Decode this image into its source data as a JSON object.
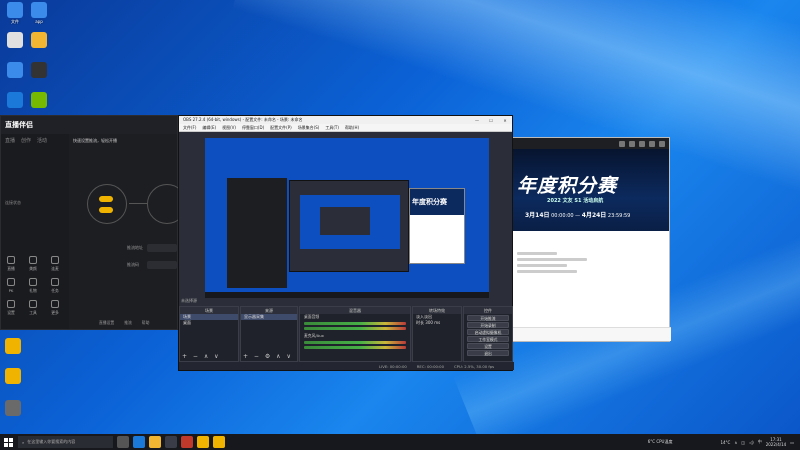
{
  "desktop": {
    "icons": [
      {
        "label": "文件",
        "color": "#3b8bea"
      },
      {
        "label": "app",
        "color": "#3b8bea"
      },
      {
        "label": "",
        "color": "#e0e0e0"
      },
      {
        "label": "",
        "color": "#f2b632"
      },
      {
        "label": "",
        "color": "#3b8bea"
      },
      {
        "label": "",
        "color": "#333333"
      },
      {
        "label": "",
        "color": "#1b7ad9"
      },
      {
        "label": "",
        "color": "#76b900"
      },
      {
        "label": "",
        "color": "#f0b400"
      },
      {
        "label": "",
        "color": "#f0b400"
      },
      {
        "label": "",
        "color": "#6a6a6a"
      }
    ]
  },
  "zhibo_app": {
    "logo": "直播伴侣",
    "tabs": [
      "直播",
      "创作",
      "活动"
    ],
    "hint": "快速设置推流，轻松开播",
    "left_label": "连接状态",
    "labels": [
      "推流地址",
      "推流码"
    ],
    "grid": [
      "直播",
      "美颜",
      "连麦",
      "PK",
      "礼物",
      "任务",
      "设置",
      "工具",
      "更多"
    ],
    "bottom": [
      "直播设置",
      "推流",
      "帮助"
    ]
  },
  "obs": {
    "title": "OBS 27.2.4 (64-bit, windows) - 配置文件: 未命名 - 场景: 未命名",
    "menu": [
      "文件(F)",
      "编辑(E)",
      "视图(V)",
      "停靠窗口(D)",
      "配置文件(P)",
      "场景集合(S)",
      "工具(T)",
      "帮助(H)"
    ],
    "dock_label": "未选择源",
    "scenes_header": "场景",
    "scenes": [
      "场景",
      "桌面"
    ],
    "sources_header": "来源",
    "sources": [
      "显示器采集"
    ],
    "mixer_header": "混音器",
    "mixer": [
      "桌面音频",
      "麦克风/Aux"
    ],
    "transition_header": "转场特效",
    "transition_value": "淡入淡出",
    "duration_label": "时长",
    "duration_value": "300 ms",
    "controls_header": "控件",
    "controls": [
      "开始推流",
      "开始录制",
      "启动虚拟摄像机",
      "工作室模式",
      "设置",
      "退出"
    ],
    "status": [
      "LIVE: 00:00:00",
      "REC: 00:00:00",
      "CPU: 2.5%, 30.00 fps"
    ]
  },
  "browser": {
    "banner_title": "年度积分赛",
    "banner_sub": "2022 文友 S1 活动启航",
    "date_start_day": "3月14日",
    "date_start_time": "00:00:00",
    "date_end_day": "4月24日",
    "date_end_time": "23:59:59"
  },
  "taskbar": {
    "search_placeholder": "在这里输入你要搜索的内容",
    "weather": "6°C",
    "weather_note": "CPU温度",
    "temp": "14°C",
    "time": "17:31",
    "date": "2022/4/14"
  }
}
